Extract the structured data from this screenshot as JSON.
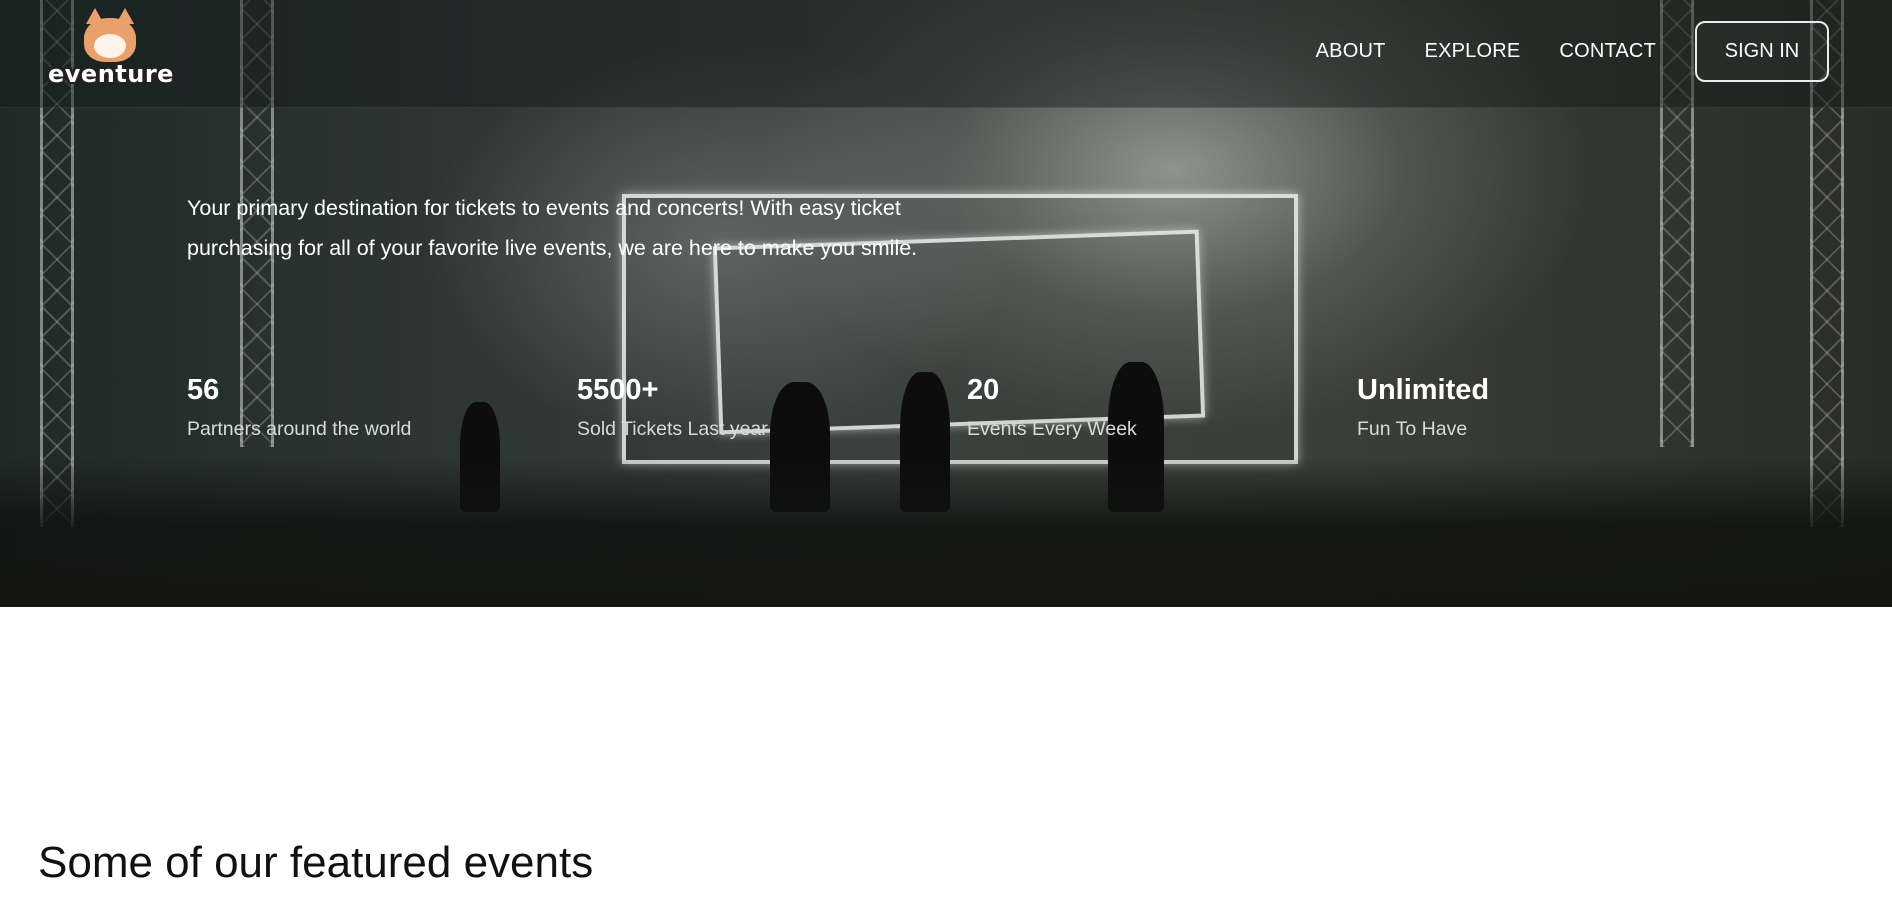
{
  "brand": {
    "logo_text": "eventure"
  },
  "nav": {
    "links": [
      "ABOUT",
      "EXPLORE",
      "CONTACT"
    ],
    "signin_label": "SIGN IN"
  },
  "hero": {
    "intro": "Your primary destination for tickets to events and concerts! With easy ticket purchasing for all of your favorite live events, we are here to make you smile.",
    "stats": [
      {
        "value": "56",
        "label": "Partners around the world"
      },
      {
        "value": "5500+",
        "label": "Sold Tickets Last year"
      },
      {
        "value": "20",
        "label": "Events Every Week"
      },
      {
        "value": "Unlimited",
        "label": "Fun To Have"
      }
    ]
  },
  "featured": {
    "heading": "Some of our featured events"
  },
  "icons": {
    "logo": "cat-mascot-icon"
  }
}
